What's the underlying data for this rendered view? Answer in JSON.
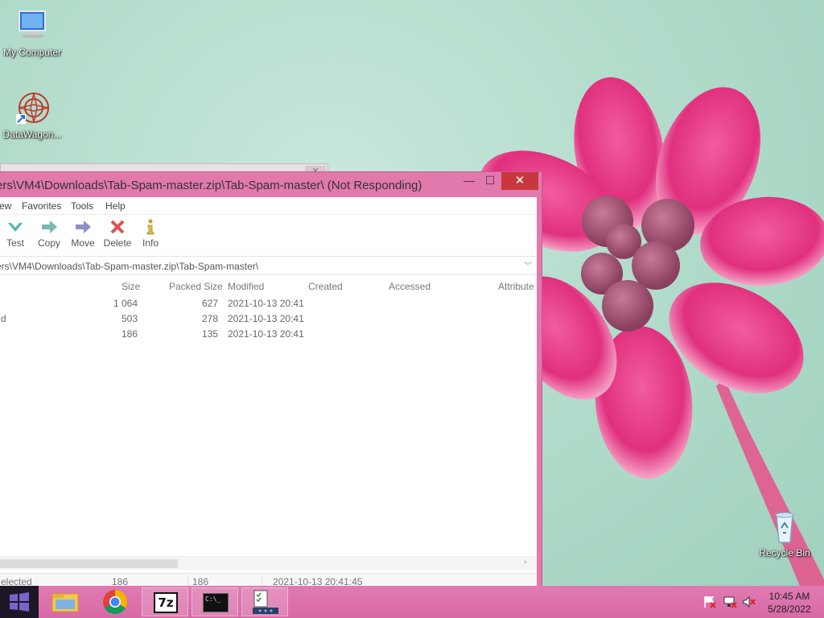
{
  "desktop": {
    "icons": [
      {
        "label": "My Computer",
        "icon": "my-computer-icon"
      },
      {
        "label": "DataWagon...",
        "icon": "datawagon-icon"
      },
      {
        "label": "Recycle Bin",
        "icon": "recycle-bin-icon"
      }
    ]
  },
  "window": {
    "title": "ers\\VM4\\Downloads\\Tab-Spam-master.zip\\Tab-Spam-master\\ (Not Responding)",
    "close_glyph": "✕",
    "max_glyph": "☐",
    "min_glyph": "—"
  },
  "menu": {
    "items": [
      "ew",
      "Favorites",
      "Tools",
      "Help"
    ]
  },
  "toolbar": {
    "buttons": [
      {
        "label": "Test",
        "icon": "test-checkmark-icon",
        "color": "#4fb8a8"
      },
      {
        "label": "Copy",
        "icon": "copy-arrow-icon",
        "color": "#7ab8b0"
      },
      {
        "label": "Move",
        "icon": "move-arrow-icon",
        "color": "#8a8fc4"
      },
      {
        "label": "Delete",
        "icon": "delete-x-icon",
        "color": "#e05050"
      },
      {
        "label": "Info",
        "icon": "info-icon",
        "color": "#c8a020"
      }
    ]
  },
  "address": {
    "path": "ers\\VM4\\Downloads\\Tab-Spam-master.zip\\Tab-Spam-master\\"
  },
  "list": {
    "columns": [
      "Size",
      "Packed Size",
      "Modified",
      "Created",
      "Accessed",
      "Attribute"
    ],
    "rows": [
      {
        "name": "",
        "size": "1 064",
        "packed": "627",
        "modified": "2021-10-13 20:41"
      },
      {
        "name": "d",
        "size": "503",
        "packed": "278",
        "modified": "2021-10-13 20:41"
      },
      {
        "name": "",
        "size": "186",
        "packed": "135",
        "modified": "2021-10-13 20:41"
      }
    ]
  },
  "status": {
    "selected": "elected",
    "size": "186",
    "packed": "186",
    "modified": "2021-10-13 20:41:45"
  },
  "taskbar": {
    "apps": [
      "start-menu",
      "file-explorer",
      "chrome",
      "7-zip",
      "command-prompt",
      "task-app"
    ],
    "sevenzip_label": "7z",
    "cmd_label": "C:\\_"
  },
  "clock": {
    "time": "10:45 AM",
    "date": "5/28/2022"
  },
  "colors": {
    "accent": "#e179ad",
    "close": "#c8373e"
  }
}
